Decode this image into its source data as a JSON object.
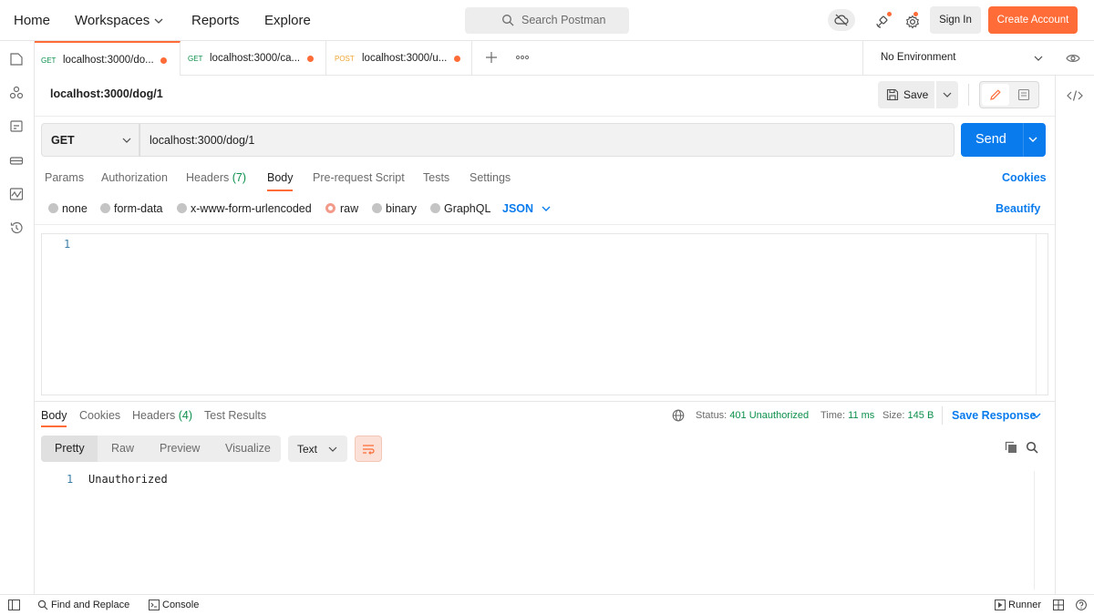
{
  "header": {
    "nav": {
      "home": "Home",
      "workspaces": "Workspaces",
      "reports": "Reports",
      "explore": "Explore"
    },
    "search_placeholder": "Search Postman",
    "sign_in": "Sign In",
    "create_account": "Create Account"
  },
  "tabs": [
    {
      "method": "GET",
      "label": "localhost:3000/do...",
      "method_color": "#0c8f4a",
      "unsaved": true
    },
    {
      "method": "GET",
      "label": "localhost:3000/ca...",
      "method_color": "#0c8f4a",
      "unsaved": true
    },
    {
      "method": "POST",
      "label": "localhost:3000/u...",
      "method_color": "#f0a535",
      "unsaved": true
    }
  ],
  "environment": "No Environment",
  "request": {
    "title": "localhost:3000/dog/1",
    "save_label": "Save",
    "method": "GET",
    "url": "localhost:3000/dog/1",
    "send_label": "Send",
    "subtabs": {
      "params": "Params",
      "authorization": "Authorization",
      "headers": "Headers",
      "headers_count": "(7)",
      "body": "Body",
      "prerequest": "Pre-request Script",
      "tests": "Tests",
      "settings": "Settings"
    },
    "cookies": "Cookies",
    "body_types": {
      "none": "none",
      "form_data": "form-data",
      "urlencoded": "x-www-form-urlencoded",
      "raw": "raw",
      "binary": "binary",
      "graphql": "GraphQL",
      "selected": "raw"
    },
    "raw_format": "JSON",
    "beautify": "Beautify",
    "editor_line": "1"
  },
  "response": {
    "tabs": {
      "body": "Body",
      "cookies": "Cookies",
      "headers": "Headers",
      "headers_count": "(4)",
      "test_results": "Test Results"
    },
    "status_label": "Status:",
    "status_value": "401 Unauthorized",
    "time_label": "Time:",
    "time_value": "11 ms",
    "size_label": "Size:",
    "size_value": "145 B",
    "save_response": "Save Response",
    "views": {
      "pretty": "Pretty",
      "raw": "Raw",
      "preview": "Preview",
      "visualize": "Visualize"
    },
    "format": "Text",
    "line_number": "1",
    "body_text": "Unauthorized"
  },
  "footer": {
    "find_replace": "Find and Replace",
    "console": "Console",
    "runner": "Runner"
  },
  "colors": {
    "accent": "#ff6c37",
    "primary": "#097bed",
    "success": "#0c8f4a"
  }
}
